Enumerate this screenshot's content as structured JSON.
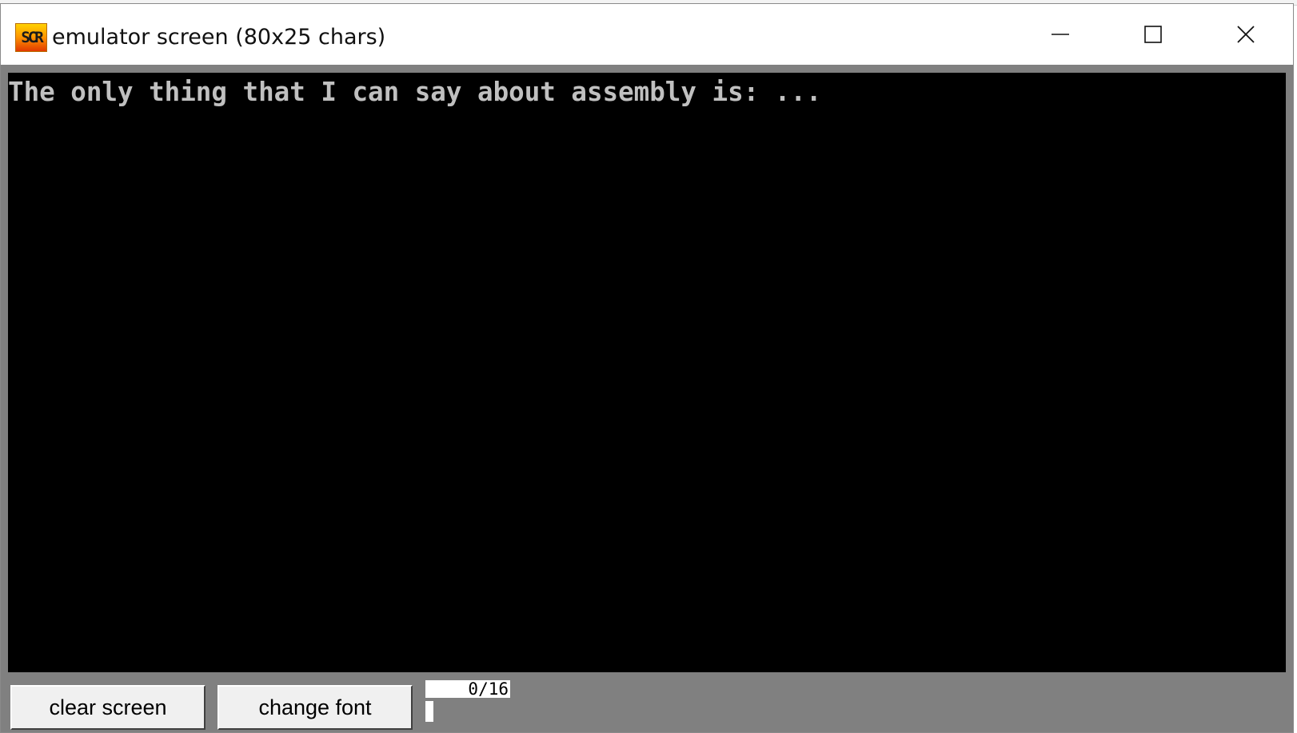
{
  "window": {
    "title": "emulator screen (80x25 chars)",
    "app_icon_text": "SCR",
    "controls": {
      "minimize": "minimize-icon",
      "maximize": "maximize-icon",
      "close": "close-icon"
    }
  },
  "screen": {
    "background": "#000000",
    "text_color": "#c0c0c0",
    "lines": [
      "The only thing that I can say about assembly is: ..."
    ]
  },
  "toolbar": {
    "clear_label": "clear screen",
    "font_label": "change font",
    "counter": "0/16"
  }
}
